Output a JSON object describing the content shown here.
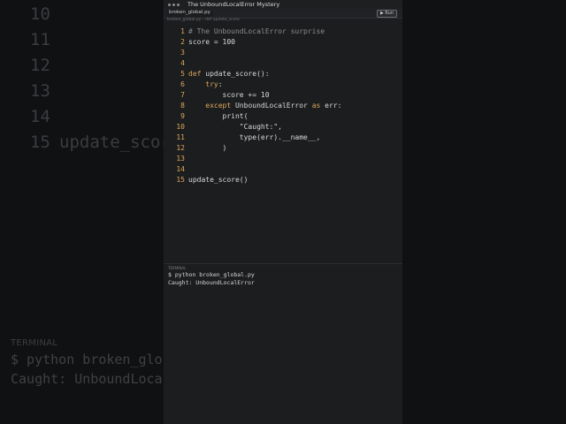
{
  "background": {
    "lines": [
      {
        "number": "10",
        "text": ""
      },
      {
        "number": "11",
        "text": ""
      },
      {
        "number": "12",
        "text": "        )"
      },
      {
        "number": "13",
        "text": ""
      },
      {
        "number": "14",
        "text": ""
      },
      {
        "number": "15",
        "text": "update_score"
      }
    ],
    "terminal_label": "TERMINAL",
    "terminal_lines": [
      "$ python broken_global",
      "Caught: UnboundLocal"
    ]
  },
  "window": {
    "title": "The UnboundLocalError Mystery"
  },
  "tab": {
    "label": "broken_global.py",
    "run_label": "Run",
    "breadcrumb": "broken_global.py › def update_score"
  },
  "editor": {
    "lines": [
      {
        "number": "1",
        "text": "# The UnboundLocalError surprise"
      },
      {
        "number": "2",
        "text": "score = 100"
      },
      {
        "number": "3",
        "text": ""
      },
      {
        "number": "4",
        "text": ""
      },
      {
        "number": "5",
        "text": "def update_score():"
      },
      {
        "number": "6",
        "text": "    try:"
      },
      {
        "number": "7",
        "text": "        score += 10"
      },
      {
        "number": "8",
        "text": "    except UnboundLocalError as err:"
      },
      {
        "number": "9",
        "text": "        print("
      },
      {
        "number": "10",
        "text": "            \"Caught:\","
      },
      {
        "number": "11",
        "text": "            type(err).__name__,"
      },
      {
        "number": "12",
        "text": "        )"
      },
      {
        "number": "13",
        "text": ""
      },
      {
        "number": "14",
        "text": ""
      },
      {
        "number": "15",
        "text": "update_score()"
      }
    ]
  },
  "terminal": {
    "label": "TERMINAL",
    "lines": [
      "$ python broken_global.py",
      "Caught: UnboundLocalError"
    ]
  },
  "colors": {
    "keyword": "#e0a85a",
    "line_number": "#e0a85a",
    "panel_bg": "#1b1d1f"
  }
}
